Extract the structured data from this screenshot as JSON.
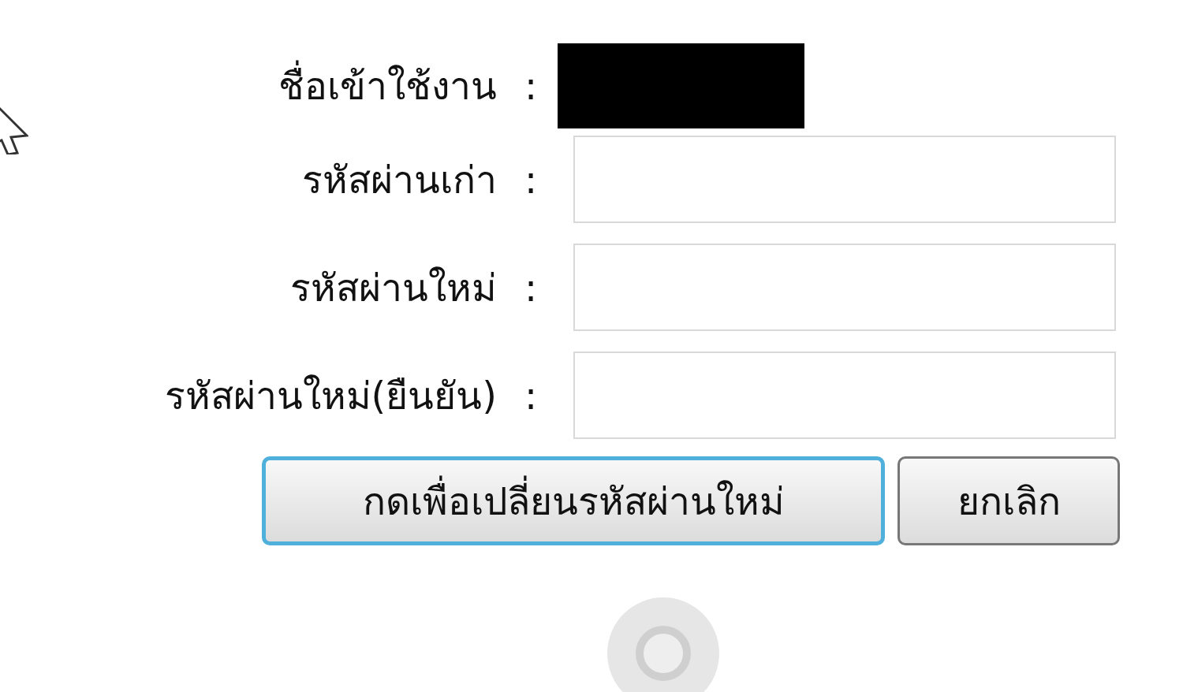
{
  "form": {
    "rows": [
      {
        "kind": "redacted",
        "label": "ชื่อเข้าใช้งาน",
        "separator": ":"
      },
      {
        "kind": "input",
        "label": "รหัสผ่านเก่า",
        "separator": ":"
      },
      {
        "kind": "input",
        "label": "รหัสผ่านใหม่",
        "separator": ":"
      },
      {
        "kind": "input",
        "label": "รหัสผ่านใหม่(ยืนยัน)",
        "separator": ":"
      }
    ],
    "buttons": [
      {
        "label": "กดเพื่อเปลี่ยนรหัสผ่านใหม่",
        "focused": true
      },
      {
        "label": "ยกเลิก",
        "focused": false
      }
    ]
  }
}
